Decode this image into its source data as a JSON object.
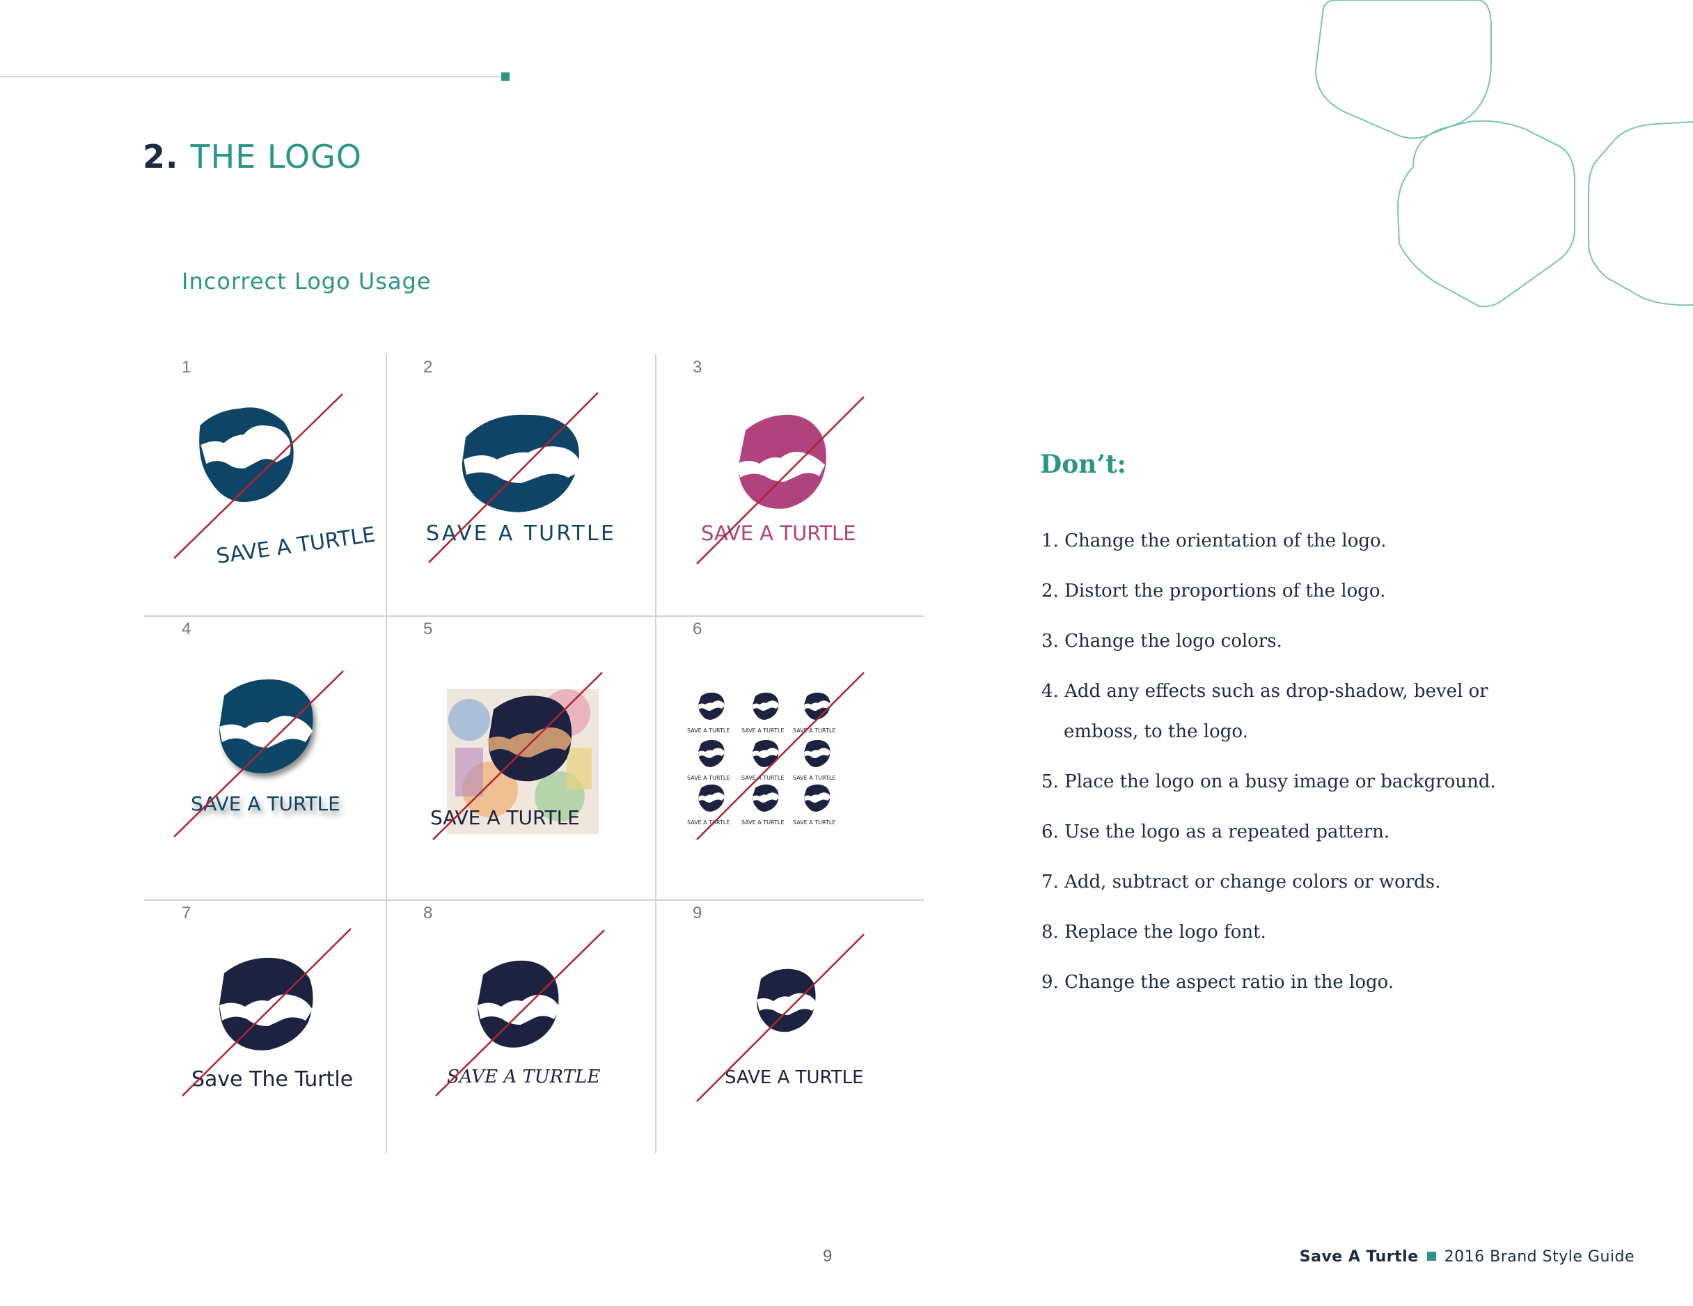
{
  "section": {
    "number": "2.",
    "title": "THE LOGO"
  },
  "subtitle": "Incorrect Logo Usage",
  "colors": {
    "accent": "#2a9684",
    "navy": "#0f4466",
    "dark_navy": "#1c2240",
    "magenta": "#b0427e",
    "strike": "#b3222e",
    "grid_line": "#d3d3d3"
  },
  "examples": [
    {
      "number": "1",
      "logo_text": "SAVE A TURTLE",
      "variant": "rotated"
    },
    {
      "number": "2",
      "logo_text": "SAVE A TURTLE",
      "variant": "stretched"
    },
    {
      "number": "3",
      "logo_text": "SAVE A TURTLE",
      "variant": "recolored"
    },
    {
      "number": "4",
      "logo_text": "SAVE A TURTLE",
      "variant": "drop-shadow"
    },
    {
      "number": "5",
      "logo_text": "SAVE A TURTLE",
      "variant": "busy-background"
    },
    {
      "number": "6",
      "logo_text": "SAVE A TURTLE",
      "variant": "repeated-pattern"
    },
    {
      "number": "7",
      "logo_text": "Save The Turtle",
      "variant": "changed-words"
    },
    {
      "number": "8",
      "logo_text": "SAVE A TURTLE",
      "variant": "replaced-font"
    },
    {
      "number": "9",
      "logo_text": "SAVE A TURTLE",
      "variant": "changed-aspect-ratio"
    }
  ],
  "dont": {
    "heading": "Don’t:",
    "rules": [
      "1. Change the orientation of the logo.",
      "2. Distort the proportions of the logo.",
      "3. Change the logo colors.",
      "4. Add any effects such as drop-shadow, bevel or emboss, to the logo.",
      "5. Place the logo on a busy image or background.",
      "6. Use the logo as a repeated pattern.",
      "7. Add, subtract or change colors or words.",
      "8. Replace the logo font.",
      "9. Change the aspect ratio in the logo."
    ]
  },
  "footer": {
    "page_number": "9",
    "brand": "Save A Turtle",
    "guide": "2016 Brand Style Guide"
  }
}
